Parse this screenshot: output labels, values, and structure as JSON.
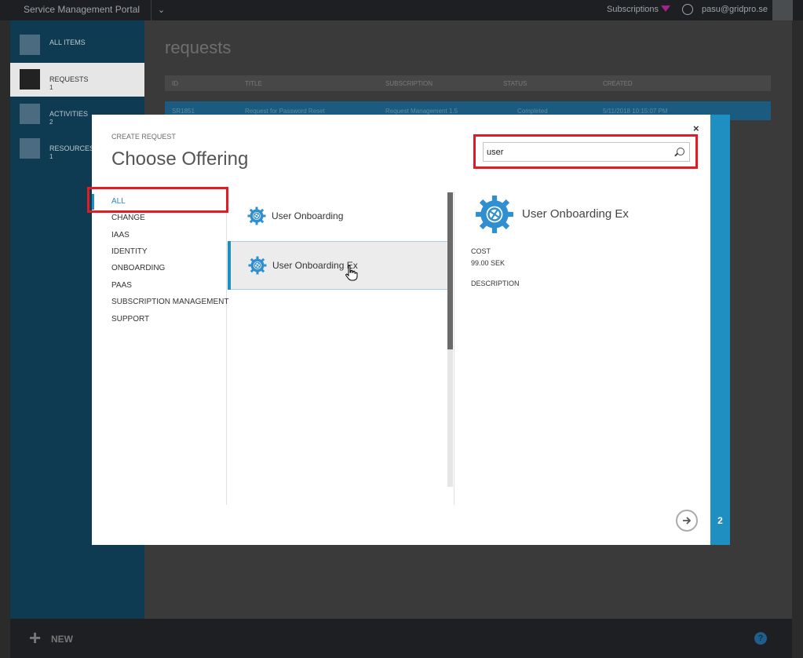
{
  "topbar": {
    "brand": "Service Management Portal",
    "subscriptions_label": "Subscriptions",
    "user_email": "pasu@gridpro.se",
    "chevron_icon": "chevron-down-icon",
    "filter_color": "#a3228c"
  },
  "leftnav": {
    "items": [
      {
        "label": "ALL ITEMS",
        "count": "",
        "icon": "grid-icon"
      },
      {
        "label": "REQUESTS",
        "count": "1",
        "icon": "requests-icon"
      },
      {
        "label": "ACTIVITIES",
        "count": "2",
        "icon": "activities-icon"
      },
      {
        "label": "RESOURCES",
        "count": "1",
        "icon": "resources-icon"
      }
    ]
  },
  "main": {
    "title": "requests",
    "columns": [
      "ID",
      "TITLE",
      "SUBSCRIPTION",
      "STATUS",
      "CREATED"
    ],
    "row": {
      "id": "SR1851",
      "title": "Request for Password Reset",
      "subscription": "Request Management 1.5",
      "status": "Completed",
      "created": "5/11/2018 10:15:07 PM"
    }
  },
  "dialog": {
    "create_label": "CREATE REQUEST",
    "title": "Choose Offering",
    "close_label": "×",
    "search_value": "user",
    "accent_color": "#1f8ec1",
    "step_number": "2",
    "categories": [
      {
        "label": "ALL"
      },
      {
        "label": "CHANGE"
      },
      {
        "label": "IAAS"
      },
      {
        "label": "IDENTITY"
      },
      {
        "label": "ONBOARDING"
      },
      {
        "label": "PAAS"
      },
      {
        "label": "SUBSCRIPTION MANAGEMENT"
      },
      {
        "label": "SUPPORT"
      }
    ],
    "offerings": [
      {
        "label": "User Onboarding",
        "icon": "gear-globe-icon"
      },
      {
        "label": "User Onboarding Ex",
        "icon": "gear-globe-icon"
      }
    ],
    "details": {
      "name": "User Onboarding Ex",
      "cost_label": "COST",
      "cost_value": "99.00 SEK",
      "description_label": "DESCRIPTION"
    }
  },
  "bottombar": {
    "new_label": "NEW",
    "help_label": "?"
  }
}
